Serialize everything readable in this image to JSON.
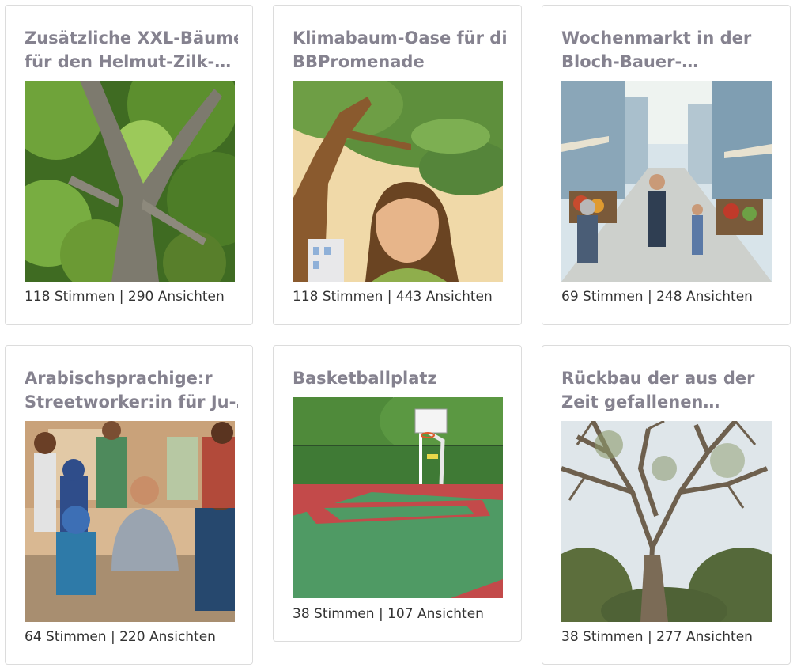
{
  "cards": [
    {
      "title_line1": "Zusätzliche XXL-Bäume",
      "title_line2": "für den Helmut-Zilk-…",
      "image_alt": "tree canopy photo",
      "stats": "118 Stimmen | 290 Ansichten"
    },
    {
      "title_line1": "Klimabaum-Oase für die",
      "title_line2": "BBPromenade",
      "image_alt": "illustration of girl under tree",
      "stats": "118 Stimmen | 443 Ansichten"
    },
    {
      "title_line1": "Wochenmarkt in der",
      "title_line2": "Bloch-Bauer-…",
      "image_alt": "street market illustration",
      "stats": "69 Stimmen | 248 Ansichten"
    },
    {
      "title_line1": "Arabischsprachige:r",
      "title_line2": "Streetworker:in für Ju-…",
      "image_alt": "group of young people with streetworker",
      "stats": "64 Stimmen | 220 Ansichten"
    },
    {
      "title_line1": "Basketballplatz",
      "title_line2": "",
      "image_alt": "outdoor basketball court",
      "stats": "38 Stimmen | 107 Ansichten"
    },
    {
      "title_line1": "Rückbau der aus der",
      "title_line2": "Zeit gefallenen…",
      "image_alt": "large bare tree",
      "stats": "38 Stimmen | 277 Ansichten"
    }
  ]
}
